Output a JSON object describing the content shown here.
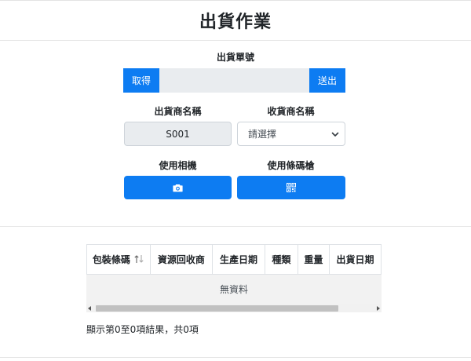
{
  "page": {
    "title": "出貨作業"
  },
  "order": {
    "label": "出貨單號",
    "fetch_label": "取得",
    "submit_label": "送出",
    "value": ""
  },
  "shipper": {
    "label": "出貨商名稱",
    "value": "S001"
  },
  "receiver": {
    "label": "收貨商名稱",
    "selected": "請選擇"
  },
  "capture": {
    "camera_label": "使用相機",
    "scanner_label": "使用條碼槍",
    "camera_icon": "camera-icon",
    "scanner_icon": "qrcode-icon"
  },
  "table": {
    "columns": [
      {
        "label": "包裝條碼",
        "sortable": true
      },
      {
        "label": "資源回收商",
        "sortable": false
      },
      {
        "label": "生產日期",
        "sortable": false
      },
      {
        "label": "種類",
        "sortable": false
      },
      {
        "label": "重量",
        "sortable": false
      },
      {
        "label": "出貨日期",
        "sortable": false
      }
    ],
    "empty_text": "無資料",
    "summary": "顯示第0至0項結果，共0項"
  },
  "colors": {
    "primary": "#0d7cf2",
    "readonly_bg": "#e9ecef",
    "empty_row_bg": "#f2f2f2"
  }
}
